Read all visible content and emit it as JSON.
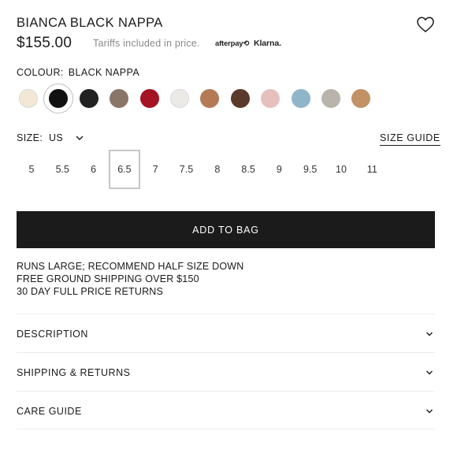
{
  "product": {
    "title": "BIANCA BLACK NAPPA",
    "price": "$155.00",
    "tariff_note": "Tariffs included in price.",
    "afterpay_logo": "afterpay⟲",
    "klarna_logo": "Klarna."
  },
  "colour": {
    "label": "COLOUR:",
    "selected": "BLACK NAPPA",
    "selected_index": 1,
    "swatches": [
      "#f2e8d5",
      "#111111",
      "#222222",
      "#8a7668",
      "#a41423",
      "#eceae7",
      "#b47a56",
      "#5a3a2a",
      "#e6c0bd",
      "#8fb5c9",
      "#b9b4ab",
      "#c19265"
    ]
  },
  "size": {
    "label": "SIZE:",
    "system": "US",
    "guide_label": "SIZE GUIDE",
    "options": [
      "5",
      "5.5",
      "6",
      "6.5",
      "7",
      "7.5",
      "8",
      "8.5",
      "9",
      "9.5",
      "10",
      "11"
    ],
    "selected": "6.5"
  },
  "add_to_bag": "ADD TO BAG",
  "notes": [
    "RUNS LARGE; RECOMMEND HALF SIZE DOWN",
    "FREE GROUND SHIPPING OVER $150",
    "30 DAY FULL PRICE RETURNS"
  ],
  "accordions": [
    "DESCRIPTION",
    "SHIPPING & RETURNS",
    "CARE GUIDE"
  ],
  "icons": {
    "wishlist": "heart-icon",
    "size_dropdown": "chevron-down-icon",
    "accordion": "chevron-down-icon"
  }
}
